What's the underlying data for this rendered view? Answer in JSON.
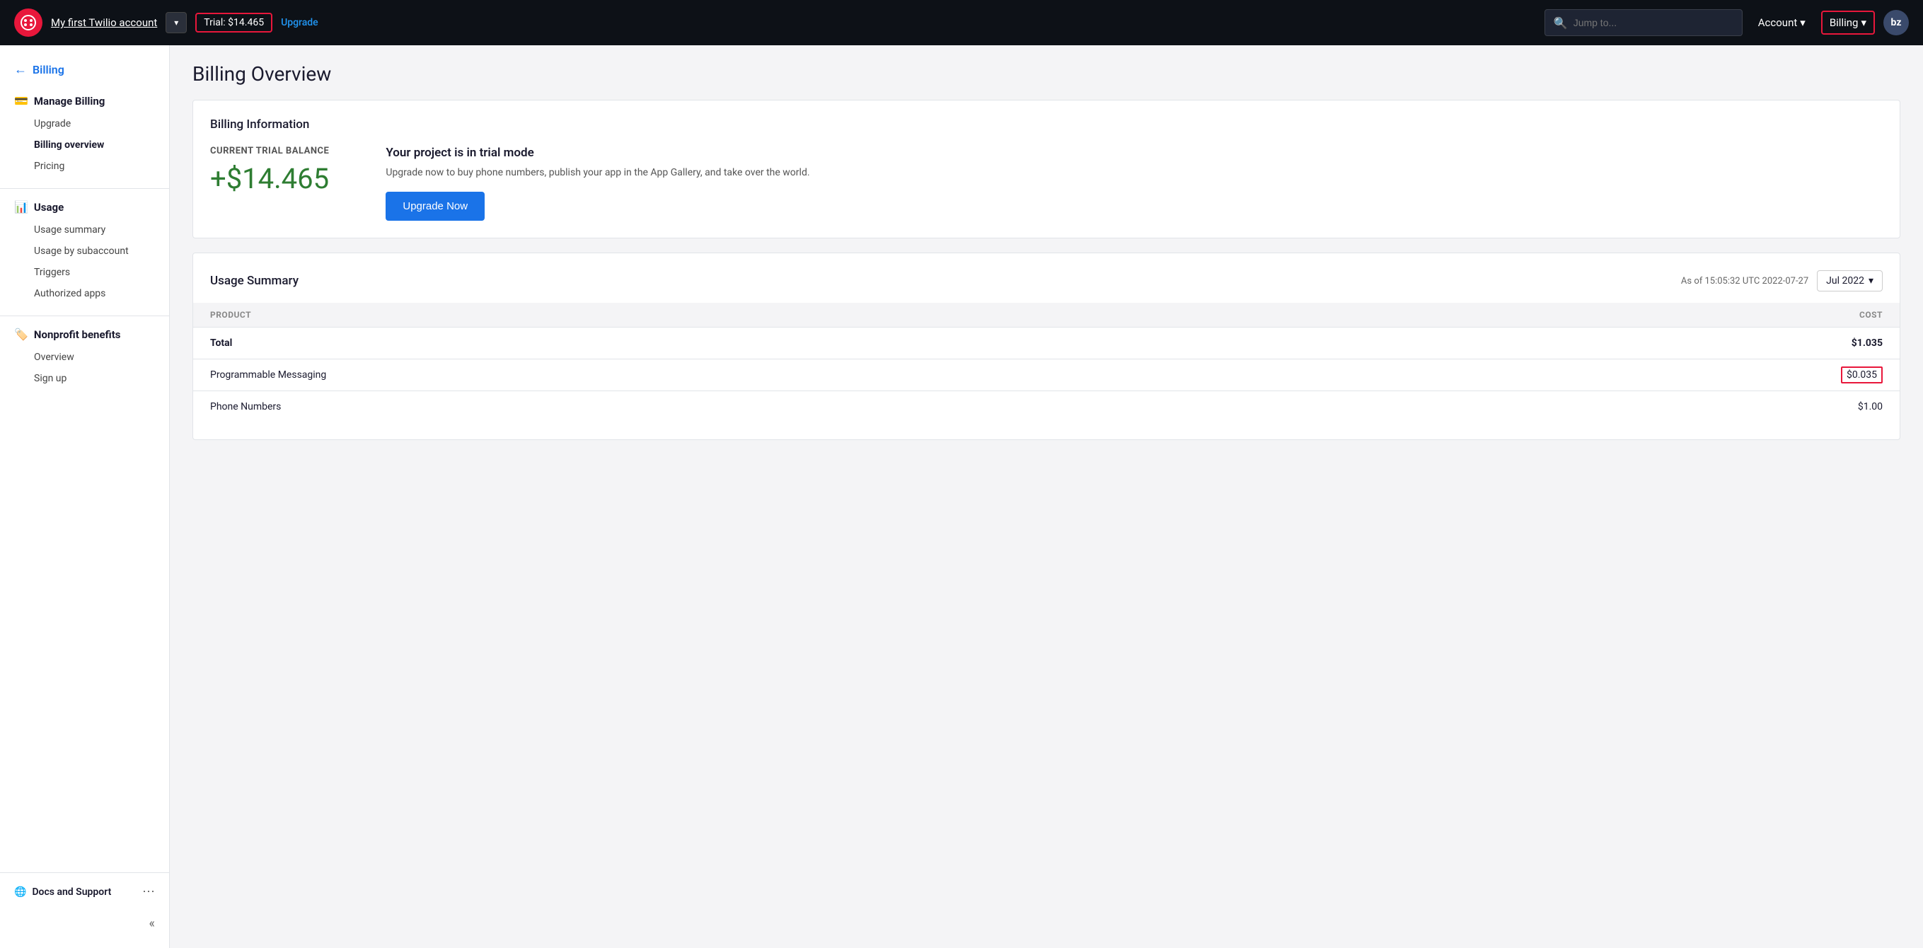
{
  "topnav": {
    "logo_text": "○",
    "account_name": "My first Twilio account",
    "trial_label": "Trial: $14.465",
    "upgrade_link_label": "Upgrade",
    "search_placeholder": "Jump to...",
    "account_btn": "Account",
    "billing_btn": "Billing",
    "avatar_initials": "bz"
  },
  "sidebar": {
    "back_label": "Billing",
    "manage_billing_label": "Manage Billing",
    "items_manage": [
      {
        "label": "Upgrade",
        "active": false
      },
      {
        "label": "Billing overview",
        "active": true
      },
      {
        "label": "Pricing",
        "active": false
      }
    ],
    "usage_label": "Usage",
    "items_usage": [
      {
        "label": "Usage summary",
        "active": false
      },
      {
        "label": "Usage by subaccount",
        "active": false
      },
      {
        "label": "Triggers",
        "active": false
      },
      {
        "label": "Authorized apps",
        "active": false
      }
    ],
    "nonprofit_label": "Nonprofit benefits",
    "items_nonprofit": [
      {
        "label": "Overview",
        "active": false
      },
      {
        "label": "Sign up",
        "active": false
      }
    ],
    "docs_label": "Docs and Support",
    "collapse_icon": "«"
  },
  "main": {
    "page_title": "Billing Overview",
    "billing_info_card": {
      "card_title": "Billing Information",
      "balance_label": "CURRENT TRIAL BALANCE",
      "balance_amount": "+$14.465",
      "trial_title": "Your project is in trial mode",
      "trial_desc": "Upgrade now to buy phone numbers, publish your app in the App Gallery, and take over the world.",
      "upgrade_btn": "Upgrade Now"
    },
    "usage_summary_card": {
      "card_title": "Usage Summary",
      "timestamp": "As of 15:05:32 UTC 2022-07-27",
      "month_selector": "Jul 2022",
      "table_headers": [
        "PRODUCT",
        "COST"
      ],
      "rows": [
        {
          "product": "Total",
          "cost": "$1.035",
          "bold": true,
          "highlighted": false
        },
        {
          "product": "Programmable Messaging",
          "cost": "$0.035",
          "bold": false,
          "highlighted": true
        },
        {
          "product": "Phone Numbers",
          "cost": "$1.00",
          "bold": false,
          "highlighted": false
        }
      ]
    }
  }
}
